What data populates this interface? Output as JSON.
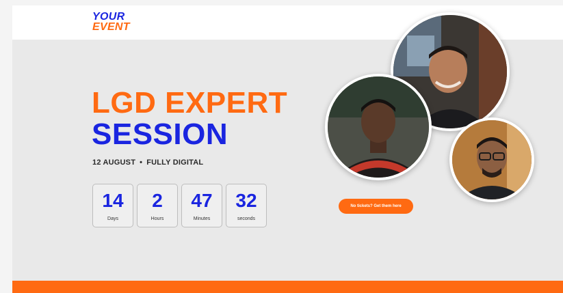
{
  "logo": {
    "line1": "YOUR",
    "line2": "EVENT"
  },
  "hero": {
    "title_line1": "LGD EXPERT",
    "title_line2": "SESSION"
  },
  "meta": {
    "date": "12 AUGUST",
    "separator": "•",
    "format": "FULLY DIGITAL"
  },
  "countdown": [
    {
      "value": "14",
      "label": "Days"
    },
    {
      "value": "2",
      "label": "Hours"
    },
    {
      "value": "47",
      "label": "Minutes"
    },
    {
      "value": "32",
      "label": "seconds"
    }
  ],
  "cta": {
    "label": "No tickets? Get them here"
  },
  "colors": {
    "orange": "#ff6a12",
    "blue": "#1a25e0"
  },
  "speakers": [
    "speaker-photo",
    "speaker-photo",
    "speaker-photo"
  ]
}
